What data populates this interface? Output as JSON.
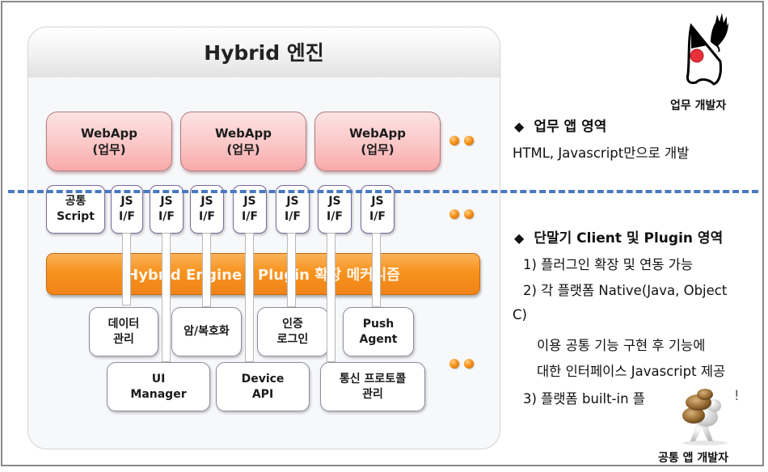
{
  "diagram": {
    "title": "Hybrid 엔진",
    "webapps": [
      {
        "line1": "WebApp",
        "line2": "(업무)"
      },
      {
        "line1": "WebApp",
        "line2": "(업무)"
      },
      {
        "line1": "WebApp",
        "line2": "(업무)"
      }
    ],
    "common_script": {
      "line1": "공통",
      "line2": "Script"
    },
    "js_if": [
      {
        "line1": "JS",
        "line2": "I/F"
      },
      {
        "line1": "JS",
        "line2": "I/F"
      },
      {
        "line1": "JS",
        "line2": "I/F"
      },
      {
        "line1": "JS",
        "line2": "I/F"
      },
      {
        "line1": "JS",
        "line2": "I/F"
      },
      {
        "line1": "JS",
        "line2": "I/F"
      },
      {
        "line1": "JS",
        "line2": "I/F"
      }
    ],
    "engine_bar": "Hybrid Engine : Plugin 확장 메커니즘",
    "modules_row1": [
      {
        "line1": "데이터",
        "line2": "관리"
      },
      {
        "line1": "암/복호화",
        "line2": ""
      },
      {
        "line1": "인증",
        "line2": "로그인"
      },
      {
        "line1": "Push",
        "line2": "Agent"
      }
    ],
    "modules_row2": [
      {
        "line1": "UI",
        "line2": "Manager"
      },
      {
        "line1": "Device",
        "line2": "API"
      },
      {
        "line1": "통신 프로토콜",
        "line2": "관리"
      }
    ],
    "colors": {
      "webapp_fill": "#fbc7c7",
      "engine_fill": "#f7931e",
      "divider": "#4a78c0",
      "dots": "#f7941d"
    }
  },
  "right": {
    "business_dev_caption": "업무 개발자",
    "business_dev_icon": "java-duke-mascot-icon",
    "section1": {
      "bullet": "◆",
      "heading": "업무 앱 영역",
      "text": "HTML, Javascript만으로 개발"
    },
    "section2": {
      "bullet": "◆",
      "heading": "단말기 Client 및 Plugin 영역",
      "lines": [
        "1) 플러그인 확장 및 연동 가능",
        "2) 각 플랫폼 Native(Java, Object",
        "C)",
        "이용 공통 기능 구현 후 기능에",
        "대한 인터페이스 Javascript 제공",
        "3) 플랫폼 built-in 플"
      ]
    },
    "common_dev_caption": "공통 앱 개발자",
    "common_dev_icon": "person-carrying-rocks-icon"
  }
}
